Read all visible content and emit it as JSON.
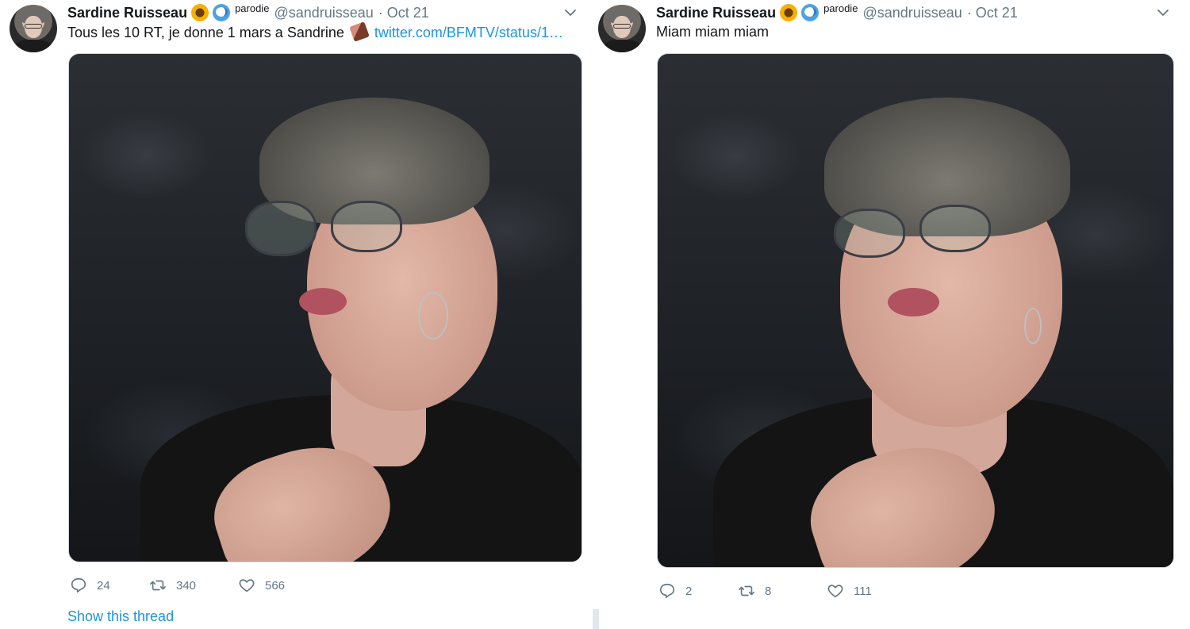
{
  "tweets": [
    {
      "author": {
        "display_name": "Sardine Ruisseau",
        "handle": "@sandruisseau",
        "badge_text": "parodie",
        "emoji_icons": [
          "sunflower-icon",
          "wave-icon"
        ]
      },
      "date": "· Oct 21",
      "text": "Tous les 10 RT, je donne 1 mars a Sandrine",
      "text_icon": "chocolate-bar-icon",
      "link": "twitter.com/BFMTV/status/1…",
      "stats": {
        "replies": "24",
        "retweets": "340",
        "likes": "566"
      },
      "show_thread": "Show this thread"
    },
    {
      "author": {
        "display_name": "Sardine Ruisseau",
        "handle": "@sandruisseau",
        "badge_text": "parodie",
        "emoji_icons": [
          "sunflower-icon",
          "wave-icon"
        ]
      },
      "date": "· Oct 21",
      "text": "Miam miam miam",
      "stats": {
        "replies": "2",
        "retweets": "8",
        "likes": "111"
      }
    }
  ],
  "colors": {
    "link": "#1b95e0",
    "muted": "#657786",
    "text": "#14171a"
  }
}
